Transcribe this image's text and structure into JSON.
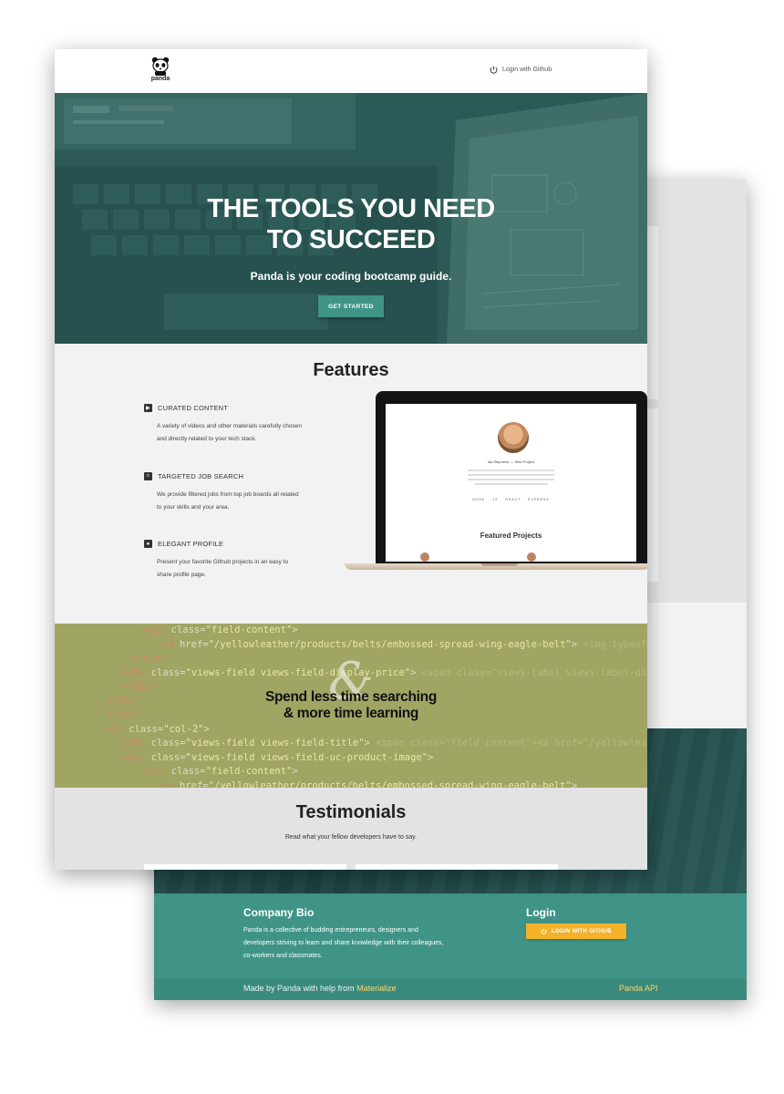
{
  "nav": {
    "logo_text": "panda",
    "login_label": "Login with Github"
  },
  "hero": {
    "title_line1": "THE TOOLS YOU NEED",
    "title_line2": "TO SUCCEED",
    "subtitle": "Panda is your coding bootcamp guide.",
    "cta_label": "GET STARTED"
  },
  "features": {
    "title": "Features",
    "items": [
      {
        "heading": "CURATED CONTENT",
        "text": "A variety of videos and other materials carefully chosen and directly related to your tech stack.",
        "icon": "video-library-icon"
      },
      {
        "heading": "TARGETED JOB SEARCH",
        "text": "We provide filtered jobs from top job boards all related to your skills and your area.",
        "icon": "search-icon"
      },
      {
        "heading": "ELEGANT PROFILE",
        "text": "Present your favorite Github projects in an easy to share profile page.",
        "icon": "profile-icon"
      }
    ],
    "laptop_screen": {
      "name": "Ida Stephens — Web Project",
      "tags": "NODE JS   REACT   EXPRESS",
      "featured_title": "Featured Projects"
    }
  },
  "code_band": {
    "ampersand": "&",
    "line1": "Spend less time searching",
    "line2": "& more time learning"
  },
  "testimonials": {
    "title": "Testimonials",
    "subtitle": "Read what your fellow developers have to say."
  },
  "footer": {
    "bio_title": "Company Bio",
    "bio_text": "Panda is a collective of budding entrepreneurs, designers and developers striving to learn and share knowledge with their colleagues, co-workers and classmates.",
    "login_title": "Login",
    "login_button": "LOGIN WITH GITHUB",
    "made_by": "Made by Panda with help from",
    "made_by_link": "Materialize",
    "api_link": "Panda API"
  },
  "colors": {
    "teal": "#3f9487",
    "dark_teal": "#234e4d",
    "olive": "#a0a564",
    "yellow_button": "#f4b22a",
    "link_yellow": "#f7d774"
  }
}
